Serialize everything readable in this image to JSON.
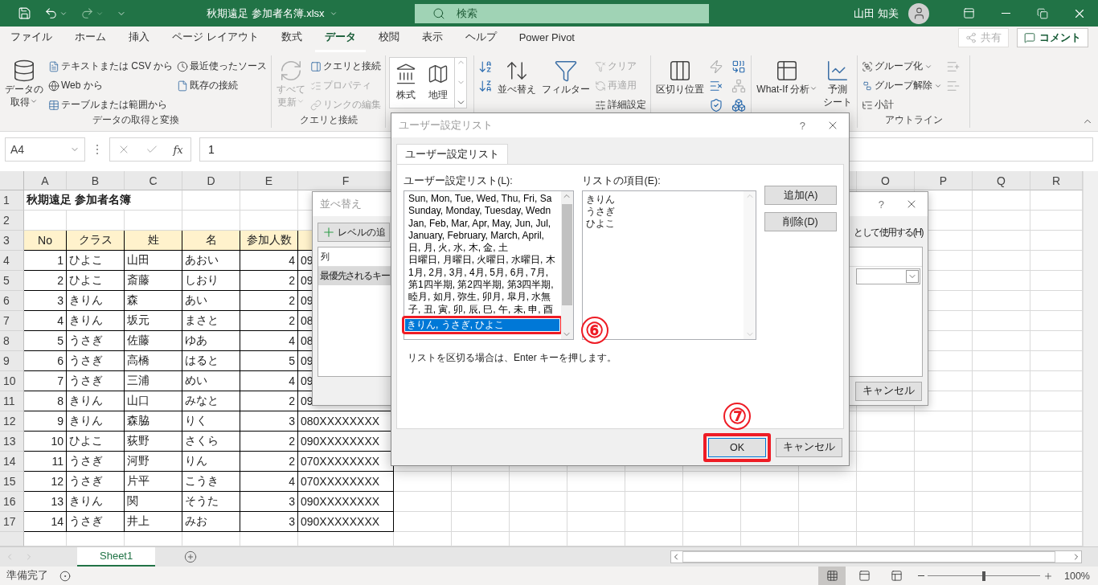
{
  "title_bar": {
    "file_name": "秋期遠足 参加者名簿.xlsx",
    "search": {
      "placeholder": "検索"
    },
    "user": "山田 知美"
  },
  "ribbon_tabs": [
    {
      "label": "ファイル",
      "selected": false
    },
    {
      "label": "ホーム",
      "selected": false
    },
    {
      "label": "挿入",
      "selected": false
    },
    {
      "label": "ページ レイアウト",
      "selected": false
    },
    {
      "label": "数式",
      "selected": false
    },
    {
      "label": "データ",
      "selected": true
    },
    {
      "label": "校閲",
      "selected": false
    },
    {
      "label": "表示",
      "selected": false
    },
    {
      "label": "ヘルプ",
      "selected": false
    },
    {
      "label": "Power Pivot",
      "selected": false
    }
  ],
  "share_button": {
    "label": "共有",
    "disabled": true
  },
  "comment_button": {
    "label": "コメント"
  },
  "ribbon_groups": [
    {
      "label": "データの取得と変換",
      "items": [
        {
          "kind": "large",
          "lines": [
            "データの",
            "取得"
          ],
          "dropdown": true,
          "disabled": false
        },
        {
          "kind": "small",
          "label": "テキストまたは CSV から",
          "dropdown": false,
          "disabled": false
        },
        {
          "kind": "small",
          "label": "Web から",
          "dropdown": false,
          "disabled": false
        },
        {
          "kind": "small",
          "label": "テーブルまたは範囲から",
          "dropdown": false,
          "disabled": false
        },
        {
          "kind": "small",
          "label": "最近使ったソース",
          "dropdown": false,
          "disabled": false
        },
        {
          "kind": "small",
          "label": "既存の接続",
          "dropdown": false,
          "disabled": false
        }
      ]
    },
    {
      "label": "クエリと接続",
      "items": [
        {
          "kind": "large",
          "lines": [
            "すべて",
            "更新"
          ],
          "dropdown": true,
          "disabled": true
        },
        {
          "kind": "small",
          "label": "クエリと接続",
          "dropdown": false,
          "disabled": false
        },
        {
          "kind": "small",
          "label": "プロパティ",
          "dropdown": false,
          "disabled": true
        },
        {
          "kind": "small",
          "label": "リンクの編集",
          "dropdown": false,
          "disabled": true
        }
      ]
    },
    {
      "items": [
        {
          "kind": "gallery",
          "label": "株式",
          "disabled": false
        },
        {
          "kind": "gallery",
          "label": "地理",
          "disabled": false
        }
      ]
    },
    {
      "items": [
        {
          "kind": "large",
          "lines": [
            "並べ替え"
          ],
          "dropdown": false,
          "disabled": false
        },
        {
          "kind": "large",
          "lines": [
            "フィルター"
          ],
          "dropdown": false,
          "disabled": false
        },
        {
          "kind": "small",
          "label": "クリア",
          "dropdown": false,
          "disabled": true
        },
        {
          "kind": "small",
          "label": "再適用",
          "dropdown": false,
          "disabled": true
        },
        {
          "kind": "small",
          "label": "詳細設定",
          "dropdown": false,
          "disabled": false
        }
      ]
    },
    {
      "items": [
        {
          "kind": "large",
          "lines": [
            "区切り位置"
          ],
          "dropdown": false,
          "disabled": false
        }
      ]
    },
    {
      "items": [
        {
          "kind": "large",
          "lines": [
            "What-If 分析"
          ],
          "dropdown": true,
          "disabled": false
        },
        {
          "kind": "large",
          "lines": [
            "予測",
            "シート"
          ],
          "dropdown": false,
          "disabled": false
        }
      ]
    },
    {
      "label": "アウトライン",
      "items": [
        {
          "kind": "small",
          "label": "グループ化",
          "dropdown": true,
          "disabled": false
        },
        {
          "kind": "small",
          "label": "グループ解除",
          "dropdown": true,
          "disabled": false
        },
        {
          "kind": "small",
          "label": "小計",
          "dropdown": false,
          "disabled": false
        }
      ]
    }
  ],
  "formula_bar": {
    "name_box": "A4",
    "function_label": "fx",
    "value": "1"
  },
  "sheet": {
    "columns": [
      "A",
      "B",
      "C",
      "D",
      "E",
      "F",
      "O",
      "P",
      "Q",
      "R"
    ],
    "row_numbers": [
      "1",
      "2",
      "3",
      "4",
      "5",
      "6",
      "7",
      "8",
      "9",
      "10",
      "11",
      "12",
      "13",
      "14",
      "15",
      "16",
      "17"
    ],
    "title": "秋期遠足 参加者名簿",
    "header": [
      "No",
      "クラス",
      "姓",
      "名",
      "参加人数"
    ],
    "records": [
      [
        "1",
        "ひよこ",
        "山田",
        "あおい",
        "4",
        "09"
      ],
      [
        "2",
        "ひよこ",
        "斎藤",
        "しおり",
        "2",
        "09"
      ],
      [
        "3",
        "きりん",
        "森",
        "あい",
        "2",
        "09"
      ],
      [
        "4",
        "きりん",
        "坂元",
        "まさと",
        "2",
        "08"
      ],
      [
        "5",
        "うさぎ",
        "佐藤",
        "ゆあ",
        "4",
        "08"
      ],
      [
        "6",
        "うさぎ",
        "高橋",
        "はると",
        "5",
        "09"
      ],
      [
        "7",
        "うさぎ",
        "三浦",
        "めい",
        "4",
        "09"
      ],
      [
        "8",
        "きりん",
        "山口",
        "みなと",
        "2",
        "09"
      ],
      [
        "9",
        "きりん",
        "森脇",
        "りく",
        "3",
        "080XXXXXXXX"
      ],
      [
        "10",
        "ひよこ",
        "荻野",
        "さくら",
        "2",
        "090XXXXXXXX"
      ],
      [
        "11",
        "うさぎ",
        "河野",
        "りん",
        "2",
        "070XXXXXXXX"
      ],
      [
        "12",
        "うさぎ",
        "片平",
        "こうき",
        "4",
        "070XXXXXXXX"
      ],
      [
        "13",
        "きりん",
        "関",
        "そうた",
        "3",
        "090XXXXXXXX"
      ],
      [
        "14",
        "うさぎ",
        "井上",
        "みお",
        "3",
        "090XXXXXXXX"
      ]
    ]
  },
  "sheet_tabs": [
    {
      "label": "Sheet1",
      "selected": true
    }
  ],
  "status_bar": {
    "status": "準備完了",
    "views": [
      {
        "selected": true
      },
      {
        "selected": false
      },
      {
        "selected": false
      }
    ],
    "zoom": {
      "level": 0.5,
      "label": "100%"
    }
  },
  "sort_dialog": {
    "title": "並べ替え",
    "help": "?",
    "add_level": "レベルの追",
    "header_option": "として使用する(H)",
    "column_header": "列",
    "key_label": "最優先されるキー",
    "cancel": "キャンセル"
  },
  "custom_list_dialog": {
    "title": "ユーザー設定リスト",
    "help": "?",
    "tabs": [
      {
        "label": "ユーザー設定リスト",
        "selected": true
      }
    ],
    "lists_label": "ユーザー設定リスト(L):",
    "entries_label": "リストの項目(E):",
    "lists": [
      {
        "text": "Sun, Mon, Tue, Wed, Thu, Fri, Sa",
        "selected": false
      },
      {
        "text": "Sunday, Monday, Tuesday, Wedn",
        "selected": false
      },
      {
        "text": "Jan, Feb, Mar, Apr, May, Jun, Jul,",
        "selected": false
      },
      {
        "text": "January, February, March, April,",
        "selected": false
      },
      {
        "text": "日, 月, 火, 水, 木, 金, 土",
        "selected": false
      },
      {
        "text": "日曜日, 月曜日, 火曜日, 水曜日, 木",
        "selected": false
      },
      {
        "text": "1月, 2月, 3月, 4月, 5月, 6月, 7月,",
        "selected": false
      },
      {
        "text": "第1四半期, 第2四半期, 第3四半期,",
        "selected": false
      },
      {
        "text": "睦月, 如月, 弥生, 卯月, 皐月, 水無",
        "selected": false
      },
      {
        "text": "子, 丑, 寅, 卯, 辰, 巳, 午, 未, 申, 酉",
        "selected": false
      },
      {
        "text": "きりん, うさぎ, ひよこ",
        "selected": true,
        "highlighted": true
      }
    ],
    "list_callout": "⑥",
    "entries": [
      "きりん",
      "うさぎ",
      "ひよこ"
    ],
    "add_button": "追加(A)",
    "delete_button": "削除(D)",
    "hint": "リストを区切る場合は、Enter キーを押します。",
    "ok_button": {
      "label": "OK",
      "highlighted": true
    },
    "ok_callout": "⑦",
    "cancel": "キャンセル"
  }
}
